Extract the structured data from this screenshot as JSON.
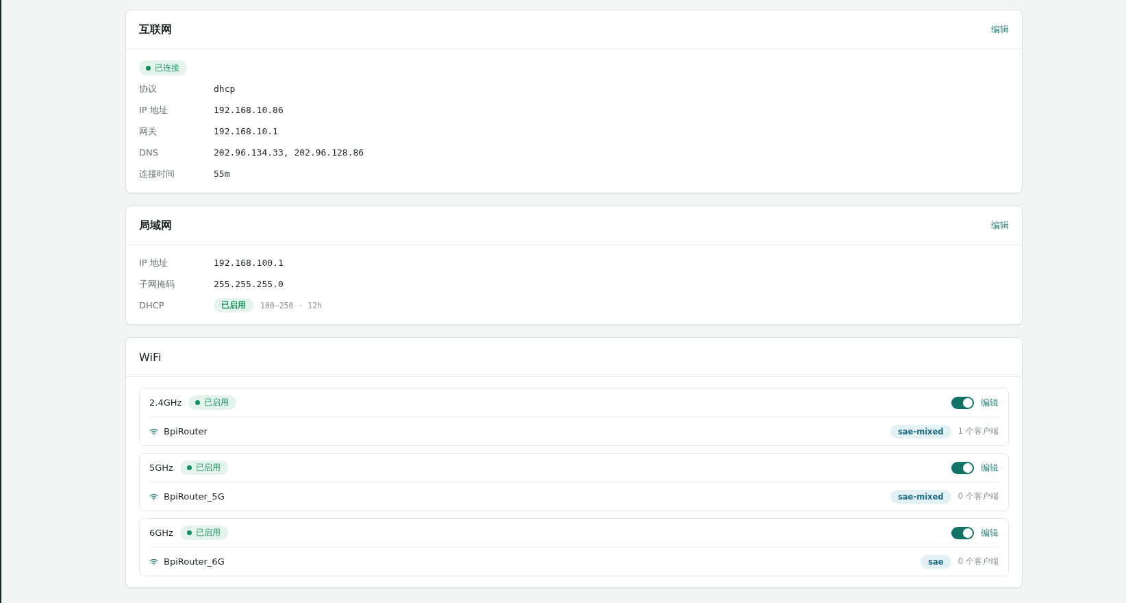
{
  "internet": {
    "title": "互联网",
    "edit": "编辑",
    "status": {
      "label": "已连接",
      "connected": true
    },
    "fields": [
      {
        "kind": "text",
        "label": "协议",
        "value": "dhcp"
      },
      {
        "kind": "text",
        "label": "IP 地址",
        "value": "192.168.10.86"
      },
      {
        "kind": "text",
        "label": "网关",
        "value": "192.168.10.1"
      },
      {
        "kind": "text",
        "label": "DNS",
        "value": "202.96.134.33, 202.96.128.86"
      },
      {
        "kind": "text",
        "label": "连接时间",
        "value": "55m"
      }
    ]
  },
  "lan": {
    "title": "局域网",
    "edit": "编辑",
    "fields": [
      {
        "kind": "text",
        "label": "IP 地址",
        "value": "192.168.100.1"
      },
      {
        "kind": "text",
        "label": "子网掩码",
        "value": "255.255.255.0"
      },
      {
        "kind": "badge",
        "label": "DHCP",
        "badge": "已启用",
        "enabled": true,
        "detail": "100–250 · 12h"
      }
    ]
  },
  "wifi": {
    "title": "WiFi",
    "bands": [
      {
        "band": "2.4GHz",
        "status": "已启用",
        "enabled": true,
        "on": true,
        "edit": "编辑",
        "ssid": "BpiRouter",
        "security": "sae-mixed",
        "clients": "1 个客户端"
      },
      {
        "band": "5GHz",
        "status": "已启用",
        "enabled": true,
        "on": true,
        "edit": "编辑",
        "ssid": "BpiRouter_5G",
        "security": "sae-mixed",
        "clients": "0 个客户端"
      },
      {
        "band": "6GHz",
        "status": "已启用",
        "enabled": true,
        "on": true,
        "edit": "编辑",
        "ssid": "BpiRouter_6G",
        "security": "sae",
        "clients": "0 个客户端"
      }
    ]
  }
}
